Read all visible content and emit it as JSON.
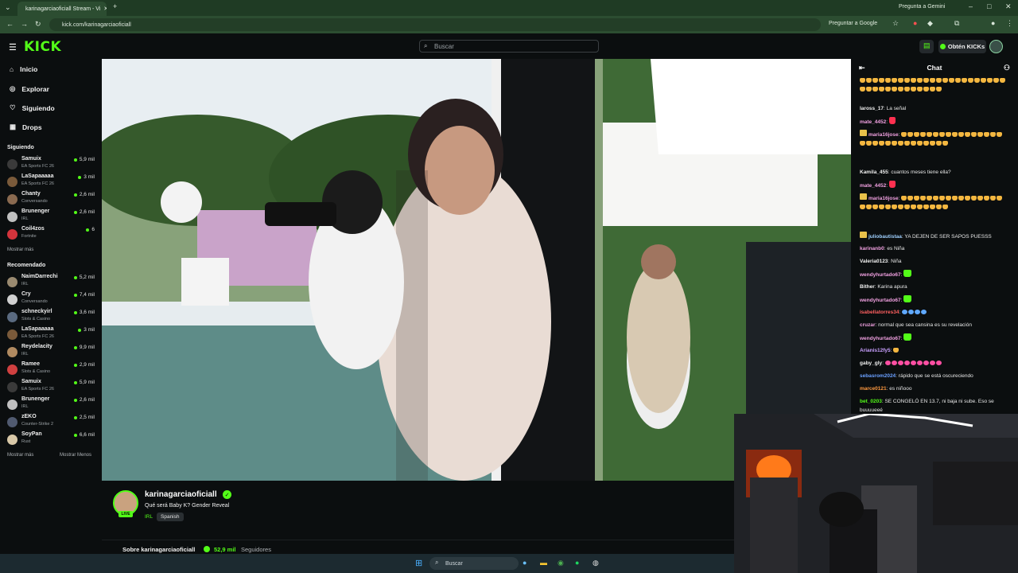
{
  "browser": {
    "tab_title": "karinagarciaoficiall Stream - Vi",
    "url": "kick.com/karinagarciaoficiall",
    "gemini_label": "Pregunta a Gemini",
    "google_label": "Preguntar a Google"
  },
  "header": {
    "logo": "KICK",
    "search_placeholder": "Buscar",
    "get_kicks": "Obtén KICKs"
  },
  "sidebar": {
    "nav": [
      "Inicio",
      "Explorar",
      "Siguiendo",
      "Drops"
    ],
    "following_title": "Siguiendo",
    "following": [
      {
        "name": "Samuix",
        "category": "EA Sports FC 26",
        "viewers": "5,9 mil",
        "color": "#3a3a3a"
      },
      {
        "name": "LaSapaaaaa",
        "category": "EA Sports FC 26",
        "viewers": "3 mil",
        "color": "#7a5a3a"
      },
      {
        "name": "Chanty",
        "category": "Conversando",
        "viewers": "2,6 mil",
        "color": "#8a6a50"
      },
      {
        "name": "Brunenger",
        "category": "IRL",
        "viewers": "2,6 mil",
        "color": "#c0c0c0"
      },
      {
        "name": "Coil4zos",
        "category": "Fortnite",
        "viewers": "6",
        "color": "#d4343c"
      }
    ],
    "show_more": "Mostrar más",
    "recommended_title": "Recomendado",
    "recommended": [
      {
        "name": "NaimDarrechi",
        "category": "IRL",
        "viewers": "5,2 mil",
        "color": "#9a8a70"
      },
      {
        "name": "Cry",
        "category": "Conversando",
        "viewers": "7,4 mil",
        "color": "#d0d0d0"
      },
      {
        "name": "schneckyirl",
        "category": "Slots & Casino",
        "viewers": "3,6 mil",
        "color": "#5a6a80"
      },
      {
        "name": "LaSapaaaaa",
        "category": "EA Sports FC 26",
        "viewers": "3 mil",
        "color": "#7a5a3a"
      },
      {
        "name": "Reydelacity",
        "category": "IRL",
        "viewers": "9,9 mil",
        "color": "#b08a60"
      },
      {
        "name": "Ramee",
        "category": "Slots & Casino",
        "viewers": "2,9 mil",
        "color": "#d04040"
      },
      {
        "name": "Samuix",
        "category": "EA Sports FC 26",
        "viewers": "5,9 mil",
        "color": "#3a3a3a"
      },
      {
        "name": "Brunenger",
        "category": "IRL",
        "viewers": "2,6 mil",
        "color": "#c0c0c0"
      },
      {
        "name": "zEKO",
        "category": "Counter-Strike 2",
        "viewers": "2,5 mil",
        "color": "#505a70"
      },
      {
        "name": "SoyPan",
        "category": "Rust",
        "viewers": "6,6 mil",
        "color": "#d8c8a8"
      }
    ],
    "show_more_2": "Mostrar más",
    "show_less": "Mostrar Menos"
  },
  "stream": {
    "channel": "karinagarciaoficiall",
    "live": "LIVE",
    "title": "Qué será Baby K? Gender Reveal",
    "category": "IRL",
    "language": "Spanish",
    "about_prefix": "Sobre karinagarciaoficiall",
    "followers": "52,9 mil",
    "followers_label": "Seguidores"
  },
  "chat": {
    "title": "Chat",
    "messages": [
      {
        "user": "laross_17",
        "color": "#f0f0f0",
        "text": "La señal"
      },
      {
        "user": "mate_4452",
        "color": "#f0a0e0",
        "text": ""
      },
      {
        "user": "maria16jose",
        "color": "#f0a0e0",
        "text": ""
      },
      {
        "user": "Kamila_455",
        "color": "#f0f0f0",
        "text": "cuantos meses tiene ella?"
      },
      {
        "user": "mate_4452",
        "color": "#f0a0e0",
        "text": ""
      },
      {
        "user": "maria16jose",
        "color": "#f0a0e0",
        "text": ""
      },
      {
        "user": "juliobautistaa",
        "color": "#9fd0ff",
        "text": "YA DEJEN DE SER SAPOS PUESSS"
      },
      {
        "user": "karinanb0",
        "color": "#f0a0e0",
        "text": "es Niña"
      },
      {
        "user": "Valeria0123",
        "color": "#f0f0f0",
        "text": "Niña"
      },
      {
        "user": "wendyhurtado67",
        "color": "#f0a0e0",
        "text": ""
      },
      {
        "user": "Bither",
        "color": "#f0f0f0",
        "text": "Karina apura"
      },
      {
        "user": "wendyhurtado67",
        "color": "#f0a0e0",
        "text": ""
      },
      {
        "user": "isabellatorres34",
        "color": "#ff6060",
        "text": ""
      },
      {
        "user": "cruzar",
        "color": "#f0a0e0",
        "text": "normal que sea cansina es su revelación"
      },
      {
        "user": "wendyhurtado67",
        "color": "#f0a0e0",
        "text": ""
      },
      {
        "user": "Arianis12fy5",
        "color": "#c9a0ff",
        "text": ""
      },
      {
        "user": "gaby_gly",
        "color": "#f0f0f0",
        "text": ""
      },
      {
        "user": "sebasrom2024",
        "color": "#6aa0ff",
        "text": "rápido que se está oscureciendo"
      },
      {
        "user": "marce0121",
        "color": "#ff9a40",
        "text": "es niñooo"
      },
      {
        "user": "bet_0203",
        "color": "#53fc18",
        "text": "SE CONGELÓ EN 13.7, ni baja ni sube. Eso se buuuueeé"
      }
    ]
  },
  "taskbar": {
    "search_label": "Buscar"
  }
}
